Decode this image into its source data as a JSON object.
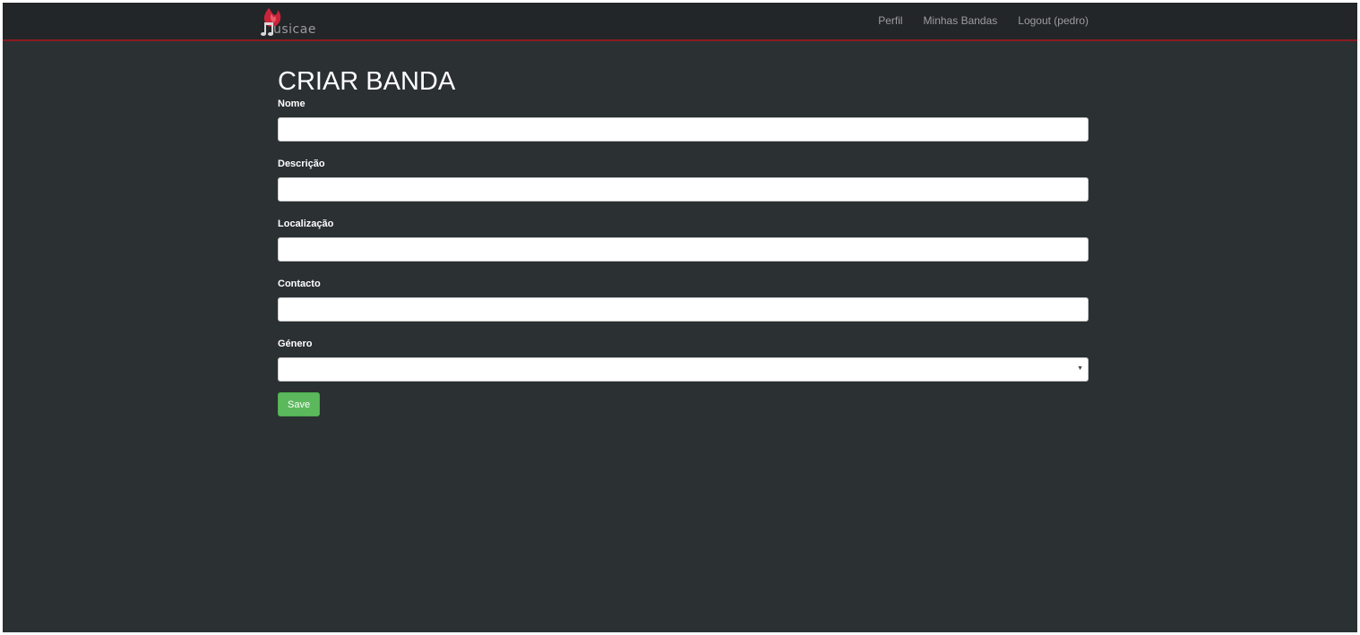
{
  "header": {
    "brand_text": "usicae",
    "logo_icon": "flame-music-note-icon",
    "nav": [
      {
        "label": "Perfil"
      },
      {
        "label": "Minhas Bandas"
      },
      {
        "label": "Logout (pedro)"
      }
    ],
    "colors": {
      "navbar_bg": "#222629",
      "navbar_border": "#8b1a1f",
      "logo_red": "#c9243a"
    }
  },
  "form": {
    "title": "CRIAR BANDA",
    "fields": [
      {
        "label": "Nome",
        "value": ""
      },
      {
        "label": "Descrição",
        "value": ""
      },
      {
        "label": "Localização",
        "value": ""
      },
      {
        "label": "Contacto",
        "value": ""
      }
    ],
    "genre": {
      "label": "Género",
      "selected": ""
    },
    "save_label": "Save",
    "colors": {
      "page_bg": "#2b3033",
      "save_bg": "#5cb85c"
    }
  }
}
